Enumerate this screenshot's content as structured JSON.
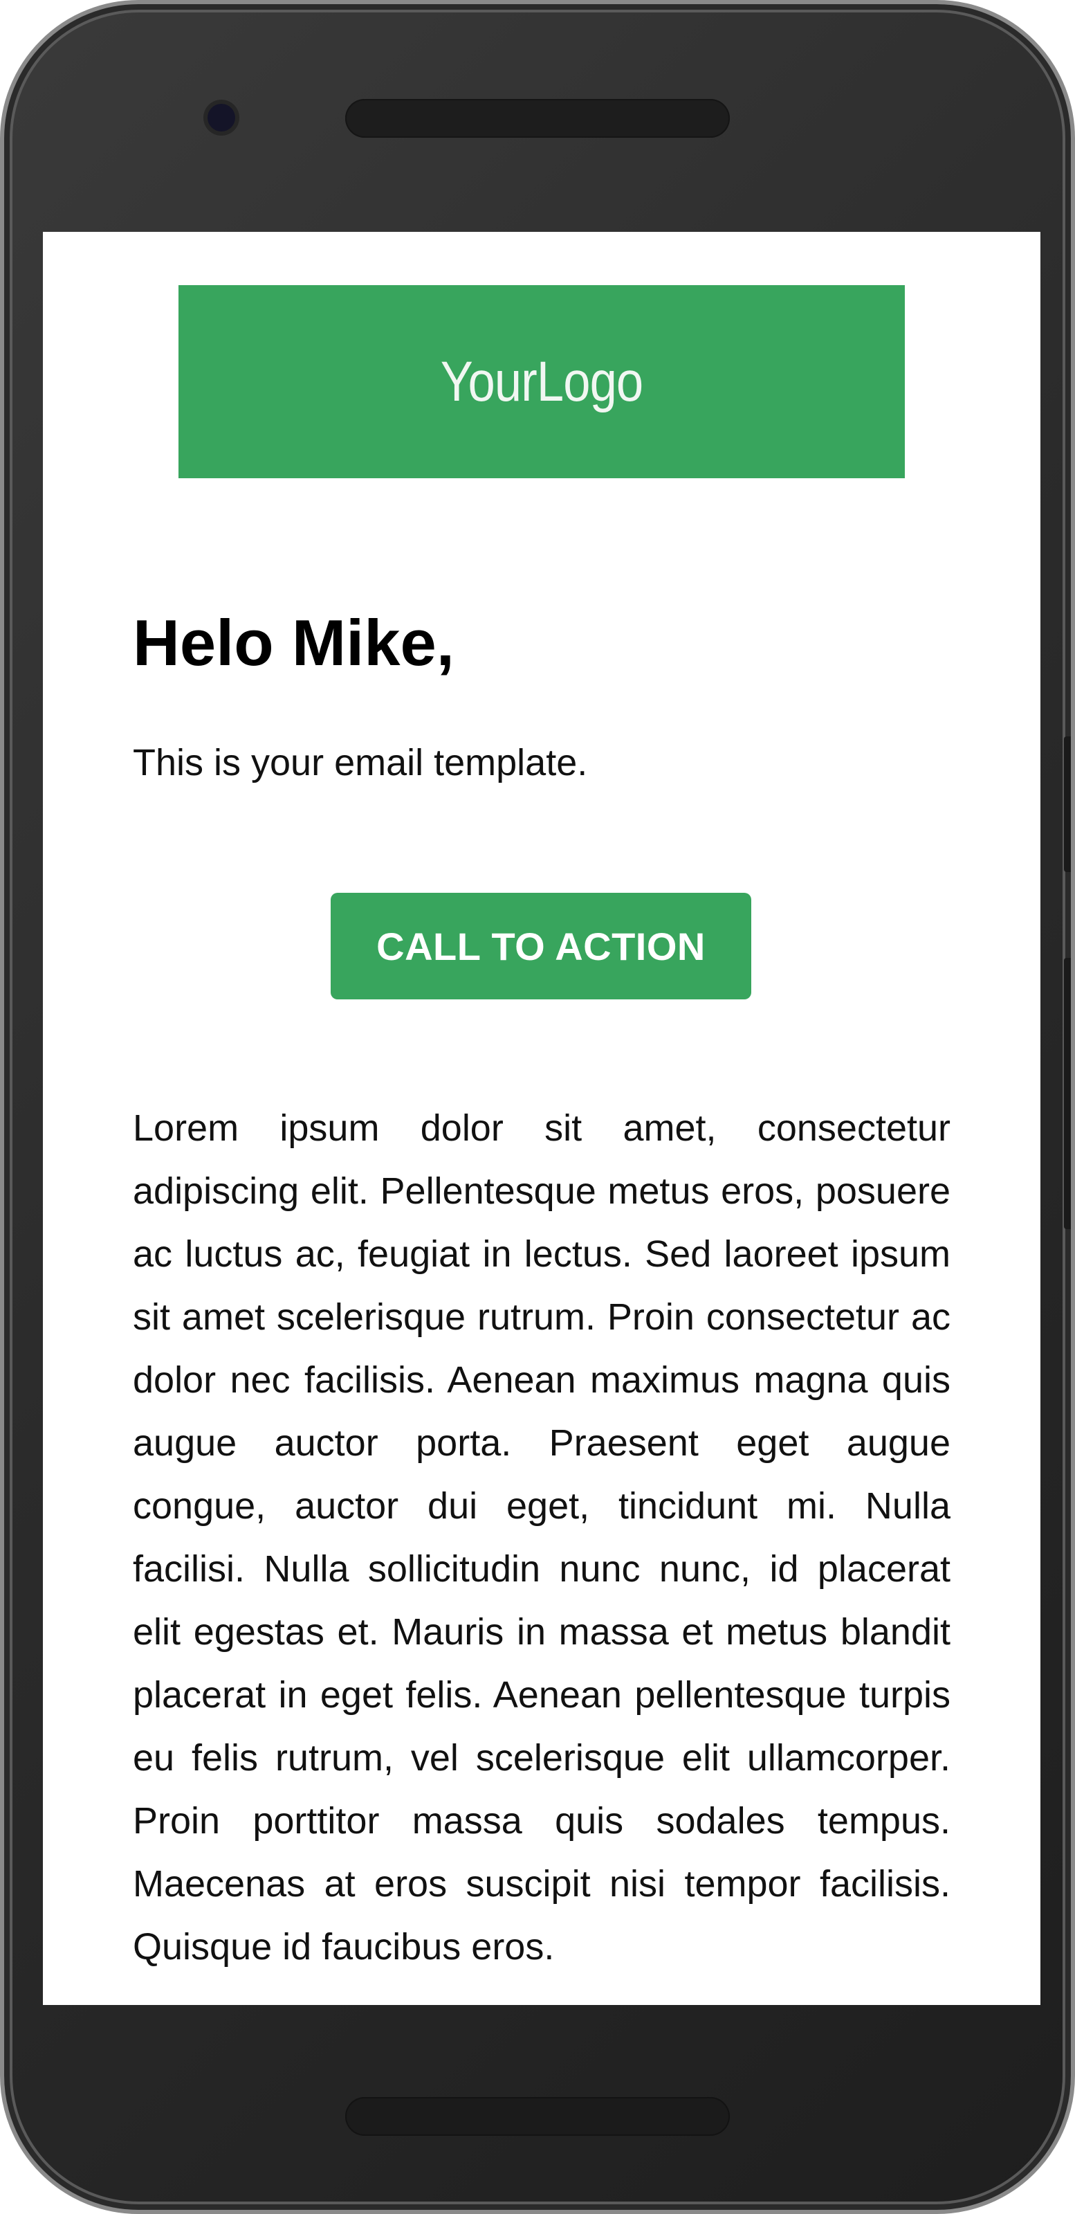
{
  "email": {
    "logo_text": "YourLogo",
    "greeting": "Helo Mike,",
    "intro": "This is your email template.",
    "cta_label": "CALL TO ACTION",
    "body": "Lorem ipsum dolor sit amet, consectetur adipiscing elit. Pellentesque metus eros, posuere ac luctus ac, feugiat in lectus. Sed laoreet ipsum sit amet scelerisque rutrum. Proin consectetur ac dolor nec facilisis. Aenean maximus magna quis augue auctor porta. Praesent eget augue congue, auctor dui eget, tincidunt mi. Nulla facilisi. Nulla sollicitudin nunc nunc, id placerat elit egestas et. Mauris in massa et metus blandit placerat in eget felis. Aenean pellentesque turpis eu felis rutrum, vel scelerisque elit ullamcorper. Proin porttitor massa quis sodales tempus. Maecenas at eros suscipit nisi tempor facilisis. Quisque id faucibus eros."
  },
  "colors": {
    "brand_green": "#38a55d",
    "device_frame": "#2b2b2b",
    "screen_background": "#ffffff",
    "text": "#111111"
  }
}
